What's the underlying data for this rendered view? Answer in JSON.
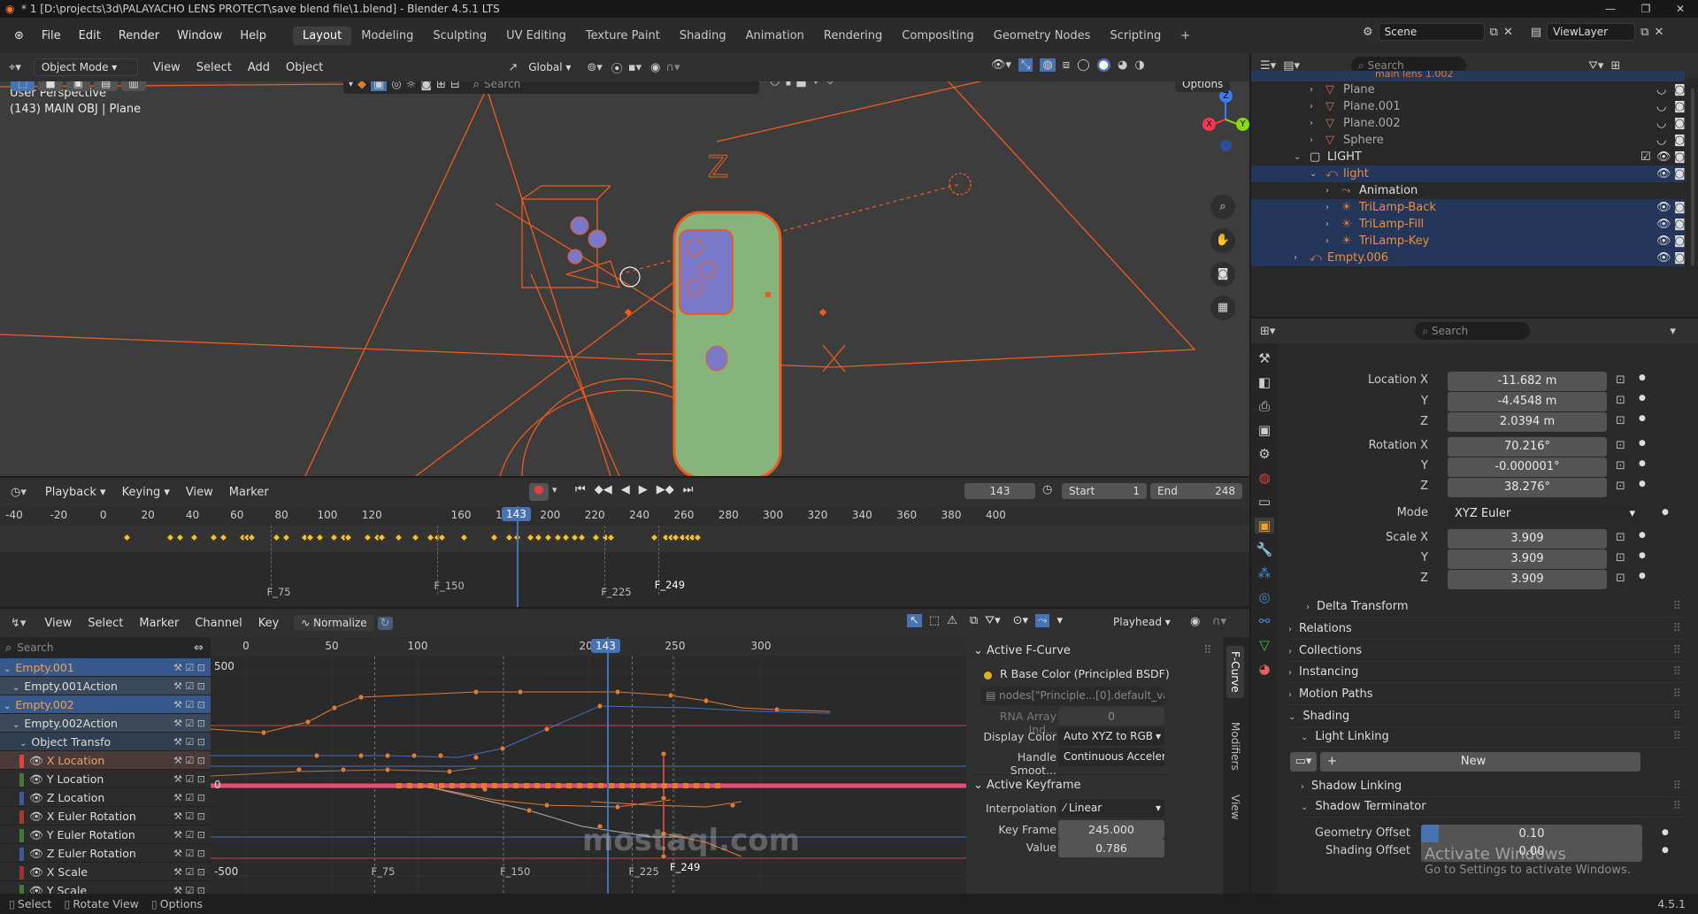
{
  "window": {
    "title": "* 1 [D:\\projects\\3d\\PALAYACHO LENS PROTECT\\save blend file\\1.blend] - Blender 4.5.1 LTS"
  },
  "menu": [
    "File",
    "Edit",
    "Render",
    "Window",
    "Help"
  ],
  "workspaces": [
    "Layout",
    "Modeling",
    "Sculpting",
    "UV Editing",
    "Texture Paint",
    "Shading",
    "Animation",
    "Rendering",
    "Compositing",
    "Geometry Nodes",
    "Scripting"
  ],
  "active_workspace": "Layout",
  "scene": {
    "scene_name": "Scene",
    "view_layer": "ViewLayer"
  },
  "viewport": {
    "mode": "Object Mode",
    "menus": [
      "View",
      "Select",
      "Add",
      "Object"
    ],
    "transform_orientation": "Global",
    "search_placeholder": "Search",
    "options_label": "Options",
    "perspective": "User Perspective",
    "object_info": "(143) MAIN OBJ | Plane",
    "gizmo": {
      "x": "X",
      "y": "Y",
      "z": "Z"
    }
  },
  "timeline": {
    "menus": [
      "Playback",
      "Keying",
      "View",
      "Marker"
    ],
    "current_frame": "143",
    "start_label": "Start",
    "start": "1",
    "end_label": "End",
    "end": "248",
    "ruler": [
      "-40",
      "-20",
      "0",
      "20",
      "40",
      "60",
      "80",
      "100",
      "120",
      "143",
      "160",
      "180",
      "200",
      "220",
      "240",
      "260",
      "280",
      "300",
      "320",
      "340",
      "360",
      "380",
      "400"
    ],
    "markers": [
      "F_75",
      "F_150",
      "F_225",
      "F_249"
    ]
  },
  "graph_editor": {
    "menus": [
      "View",
      "Select",
      "Marker",
      "Channel",
      "Key"
    ],
    "normalize_label": "Normalize",
    "pivot_label": "Playhead",
    "search_placeholder": "Search",
    "ruler": [
      "0",
      "50",
      "100",
      "143",
      "200",
      "250",
      "300"
    ],
    "y_labels": [
      "500",
      "0",
      "-500"
    ],
    "markers": [
      "F_75",
      "F_150",
      "F_225",
      "F_249"
    ],
    "channels": [
      {
        "label": "Empty.001",
        "type": "object"
      },
      {
        "label": "Empty.001Action",
        "type": "action"
      },
      {
        "label": "Empty.002",
        "type": "object"
      },
      {
        "label": "Empty.002Action",
        "type": "action"
      },
      {
        "label": "Object Transfo",
        "type": "group"
      },
      {
        "label": "X Location",
        "type": "curve",
        "color": "#e8403c"
      },
      {
        "label": "Y Location",
        "type": "curve",
        "color": "#3f7a3a"
      },
      {
        "label": "Z Location",
        "type": "curve",
        "color": "#3a5a9a"
      },
      {
        "label": "X Euler Rotation",
        "type": "curve",
        "color": "#a63a2e"
      },
      {
        "label": "Y Euler Rotation",
        "type": "curve",
        "color": "#3f7a3a"
      },
      {
        "label": "Z Euler Rotation",
        "type": "curve",
        "color": "#3a5a9a"
      },
      {
        "label": "X Scale",
        "type": "curve",
        "color": "#a0302e"
      },
      {
        "label": "Y Scale",
        "type": "curve",
        "color": "#3f7a3a"
      }
    ]
  },
  "npanel": {
    "tabs": [
      "F-Curve",
      "Modifiers",
      "View"
    ],
    "active_fcurve_title": "Active F-Curve",
    "fcurve_name": "R Base Color (Principled BSDF)",
    "data_path": "nodes[\"Principle...[0].default_value",
    "rna_label": "RNA Array Ind...",
    "rna_value": "0",
    "display_color_label": "Display Color",
    "display_color": "Auto XYZ to RGB",
    "handle_smooth_label": "Handle Smoot...",
    "handle_smooth": "Continuous Acceler...",
    "active_keyframe_title": "Active Keyframe",
    "interpolation_label": "Interpolation",
    "interpolation": "Linear",
    "key_frame_label": "Key Frame",
    "key_frame": "245.000",
    "value_label": "Value",
    "value": "0.786"
  },
  "outliner": {
    "search_placeholder": "Search",
    "rows": [
      {
        "label": "Plane",
        "indent": 2
      },
      {
        "label": "Plane.001",
        "indent": 2
      },
      {
        "label": "Plane.002",
        "indent": 2
      },
      {
        "label": "Sphere",
        "indent": 2
      },
      {
        "label": "LIGHT",
        "indent": 1
      },
      {
        "label": "light",
        "indent": 2
      },
      {
        "label": "Animation",
        "indent": 3
      },
      {
        "label": "TriLamp-Back",
        "indent": 3
      },
      {
        "label": "TriLamp-Fill",
        "indent": 3
      },
      {
        "label": "TriLamp-Key",
        "indent": 3
      },
      {
        "label": "Empty.006",
        "indent": 1
      }
    ],
    "top_partial": "main lens 1.002"
  },
  "properties": {
    "search_placeholder": "Search",
    "location_label": "Location X",
    "location": [
      "-11.682 m",
      "-4.4548 m",
      "2.0394 m"
    ],
    "rotation_label": "Rotation X",
    "rotation": [
      "70.216°",
      "-0.000001°",
      "38.276°"
    ],
    "mode_label": "Mode",
    "mode": "XYZ Euler",
    "scale_label": "Scale X",
    "scale": [
      "3.909",
      "3.909",
      "3.909"
    ],
    "axis_y": "Y",
    "axis_z": "Z",
    "sections": [
      "Delta Transform",
      "Relations",
      "Collections",
      "Instancing",
      "Motion Paths",
      "Shading",
      "Light Linking",
      "Shadow Linking",
      "Shadow Terminator"
    ],
    "new_label": "New",
    "geometry_offset_label": "Geometry Offset",
    "geometry_offset": "0.10",
    "shading_offset_label": "Shading Offset",
    "shading_offset": "0.00"
  },
  "overlay": {
    "activate_title": "Activate Windows",
    "activate_sub": "Go to Settings to activate Windows.",
    "watermark": "mostaql.com"
  },
  "status": {
    "select": "Select",
    "rotate": "Rotate View",
    "options": "Options",
    "version": "4.5.1"
  }
}
